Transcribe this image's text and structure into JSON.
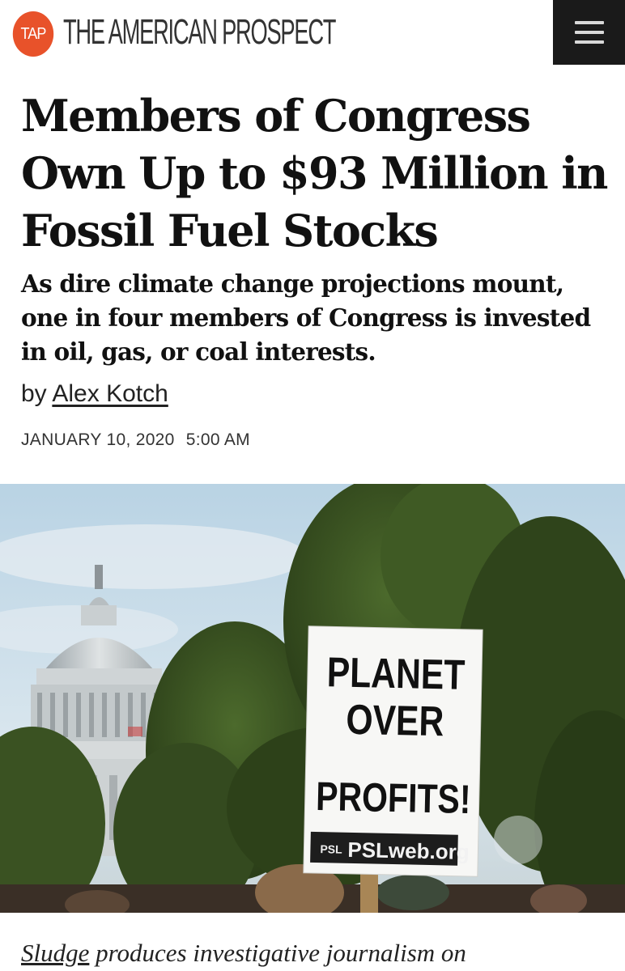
{
  "header": {
    "logo_badge": "TAP",
    "logo_text": "THE AMERICAN PROSPECT",
    "menu_icon": "hamburger-menu-icon",
    "brand_color": "#e8522a"
  },
  "article": {
    "headline": "Members of Congress Own Up to $93 Million in Fossil Fuel Stocks",
    "dek": "As dire climate change projections mount, one in four members of Congress is invested in oil, gas, or coal interests.",
    "byline_prefix": "by",
    "author": "Alex Kotch",
    "date": "JANUARY 10, 2020",
    "time": "5:00 AM",
    "image": {
      "sign_line1": "PLANET",
      "sign_line2": "OVER",
      "sign_line3": "PROFITS!",
      "sign_footer_logo": "PSL",
      "sign_footer_url": "PSLweb.org"
    },
    "body_link": "Sludge",
    "body_text": " produces investigative journalism on"
  }
}
